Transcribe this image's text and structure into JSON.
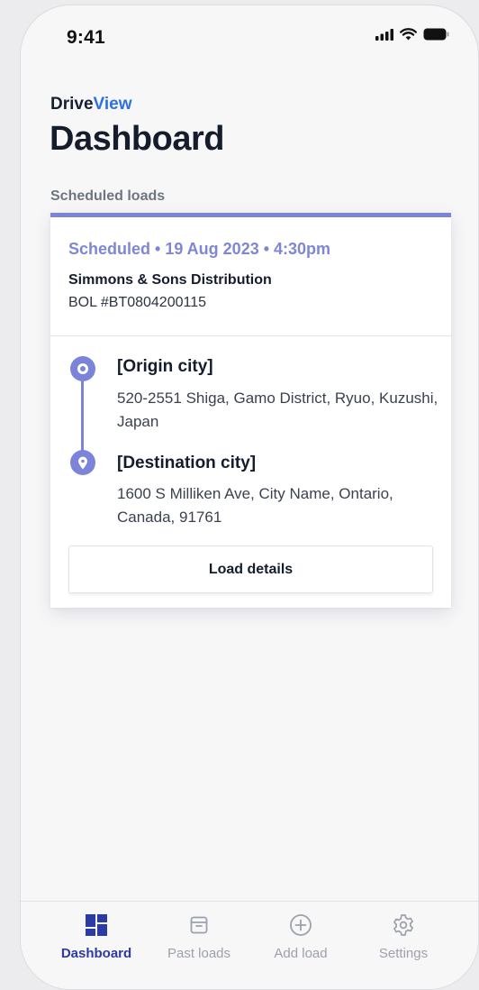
{
  "status_bar": {
    "time": "9:41"
  },
  "brand": {
    "part1": "Drive",
    "part2": "View"
  },
  "page": {
    "title": "Dashboard",
    "section_label": "Scheduled loads"
  },
  "load": {
    "schedule": "Scheduled • 19 Aug 2023 • 4:30pm",
    "company": "Simmons & Sons Distribution",
    "bol": "BOL #BT0804200115",
    "origin": {
      "title": "[Origin city]",
      "address": "520-2551 Shiga, Gamo District, Ryuo, Kuzushi, Japan"
    },
    "destination": {
      "title": "[Destination city]",
      "address": "1600 S Milliken Ave, City Name, Ontario, Canada, 91761"
    },
    "details_label": "Load details"
  },
  "tabs": [
    {
      "label": "Dashboard",
      "icon": "dashboard-icon",
      "active": true
    },
    {
      "label": "Past loads",
      "icon": "archive-icon",
      "active": false
    },
    {
      "label": "Add load",
      "icon": "add-circle-icon",
      "active": false
    },
    {
      "label": "Settings",
      "icon": "gear-icon",
      "active": false
    }
  ],
  "colors": {
    "accent": "#7b84d8",
    "brand_blue": "#2f6fe4",
    "active_tab": "#2b3ba3",
    "inactive_tab": "#9ca1ab"
  }
}
